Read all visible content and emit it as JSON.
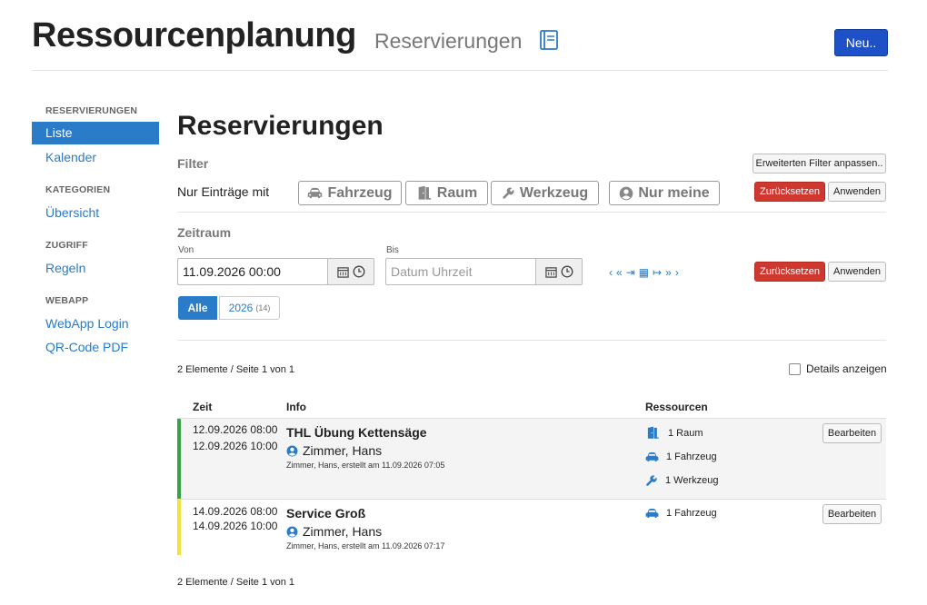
{
  "header": {
    "title": "Ressourcenplanung",
    "subtitle": "Reservierungen",
    "new_label": "Neu.."
  },
  "sidebar": {
    "sections": [
      {
        "heading": "RESERVIERUNGEN",
        "items": [
          "Liste",
          "Kalender"
        ]
      },
      {
        "heading": "KATEGORIEN",
        "items": [
          "Übersicht"
        ]
      },
      {
        "heading": "ZUGRIFF",
        "items": [
          "Regeln"
        ]
      },
      {
        "heading": "WEBAPP",
        "items": [
          "WebApp Login",
          "QR-Code PDF"
        ]
      }
    ]
  },
  "main": {
    "title": "Reservierungen",
    "filter": {
      "label": "Filter",
      "advanced_label": "Erweiterten Filter anpassen..",
      "only_label": "Nur Einträge mit",
      "buttons": [
        "Fahrzeug",
        "Raum",
        "Werkzeug",
        "Nur meine"
      ],
      "reset_label": "Zurücksetzen",
      "apply_label": "Anwenden"
    },
    "period": {
      "label": "Zeitraum",
      "from_label": "Von",
      "from_value": "11.09.2026 00:00",
      "to_label": "Bis",
      "to_placeholder": "Datum Uhrzeit",
      "nav": [
        "‹",
        "«",
        "⇥",
        "▦",
        "↦",
        "»",
        "›"
      ],
      "reset_label": "Zurücksetzen",
      "apply_label": "Anwenden",
      "pill_all": "Alle",
      "pill_year": "2026",
      "pill_year_count": "(14)"
    },
    "list": {
      "count_text": "2 Elemente / Seite 1 von 1",
      "details_label": "Details anzeigen",
      "columns": {
        "time": "Zeit",
        "info": "Info",
        "resources": "Ressourcen"
      },
      "edit_label": "Bearbeiten",
      "rows": [
        {
          "start": "12.09.2026 08:00",
          "end": "12.09.2026 10:00",
          "title": "THL Übung Kettensäge",
          "person": "Zimmer, Hans",
          "meta": "Zimmer, Hans, erstellt am 11.09.2026 07:05",
          "bar_color": "#3aa34a",
          "resources": [
            "1 Raum",
            "1 Fahrzeug",
            "1 Werkzeug"
          ]
        },
        {
          "start": "14.09.2026 08:00",
          "end": "14.09.2026 10:00",
          "title": "Service Groß",
          "person": "Zimmer, Hans",
          "meta": "Zimmer, Hans, erstellt am 11.09.2026 07:17",
          "bar_color": "#f0e23c",
          "resources": [
            "1 Fahrzeug"
          ]
        }
      ],
      "footer_text": "2 Elemente / Seite 1 von 1"
    }
  }
}
